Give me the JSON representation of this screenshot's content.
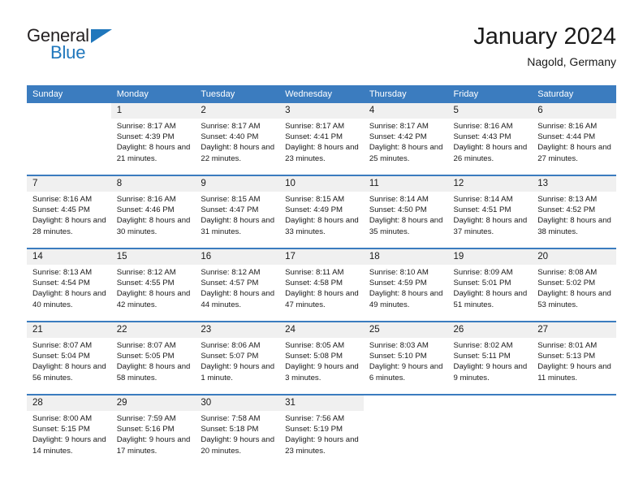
{
  "brand": {
    "name_part1": "General",
    "name_part2": "Blue",
    "accent_color": "#1f77bc"
  },
  "header": {
    "title": "January 2024",
    "subtitle": "Nagold, Germany"
  },
  "calendar": {
    "header_color": "#3b7cbf",
    "weekdays": [
      "Sunday",
      "Monday",
      "Tuesday",
      "Wednesday",
      "Thursday",
      "Friday",
      "Saturday"
    ],
    "weeks": [
      [
        {
          "day": "",
          "sunrise": "",
          "sunset": "",
          "daylight": ""
        },
        {
          "day": "1",
          "sunrise": "Sunrise: 8:17 AM",
          "sunset": "Sunset: 4:39 PM",
          "daylight": "Daylight: 8 hours and 21 minutes."
        },
        {
          "day": "2",
          "sunrise": "Sunrise: 8:17 AM",
          "sunset": "Sunset: 4:40 PM",
          "daylight": "Daylight: 8 hours and 22 minutes."
        },
        {
          "day": "3",
          "sunrise": "Sunrise: 8:17 AM",
          "sunset": "Sunset: 4:41 PM",
          "daylight": "Daylight: 8 hours and 23 minutes."
        },
        {
          "day": "4",
          "sunrise": "Sunrise: 8:17 AM",
          "sunset": "Sunset: 4:42 PM",
          "daylight": "Daylight: 8 hours and 25 minutes."
        },
        {
          "day": "5",
          "sunrise": "Sunrise: 8:16 AM",
          "sunset": "Sunset: 4:43 PM",
          "daylight": "Daylight: 8 hours and 26 minutes."
        },
        {
          "day": "6",
          "sunrise": "Sunrise: 8:16 AM",
          "sunset": "Sunset: 4:44 PM",
          "daylight": "Daylight: 8 hours and 27 minutes."
        }
      ],
      [
        {
          "day": "7",
          "sunrise": "Sunrise: 8:16 AM",
          "sunset": "Sunset: 4:45 PM",
          "daylight": "Daylight: 8 hours and 28 minutes."
        },
        {
          "day": "8",
          "sunrise": "Sunrise: 8:16 AM",
          "sunset": "Sunset: 4:46 PM",
          "daylight": "Daylight: 8 hours and 30 minutes."
        },
        {
          "day": "9",
          "sunrise": "Sunrise: 8:15 AM",
          "sunset": "Sunset: 4:47 PM",
          "daylight": "Daylight: 8 hours and 31 minutes."
        },
        {
          "day": "10",
          "sunrise": "Sunrise: 8:15 AM",
          "sunset": "Sunset: 4:49 PM",
          "daylight": "Daylight: 8 hours and 33 minutes."
        },
        {
          "day": "11",
          "sunrise": "Sunrise: 8:14 AM",
          "sunset": "Sunset: 4:50 PM",
          "daylight": "Daylight: 8 hours and 35 minutes."
        },
        {
          "day": "12",
          "sunrise": "Sunrise: 8:14 AM",
          "sunset": "Sunset: 4:51 PM",
          "daylight": "Daylight: 8 hours and 37 minutes."
        },
        {
          "day": "13",
          "sunrise": "Sunrise: 8:13 AM",
          "sunset": "Sunset: 4:52 PM",
          "daylight": "Daylight: 8 hours and 38 minutes."
        }
      ],
      [
        {
          "day": "14",
          "sunrise": "Sunrise: 8:13 AM",
          "sunset": "Sunset: 4:54 PM",
          "daylight": "Daylight: 8 hours and 40 minutes."
        },
        {
          "day": "15",
          "sunrise": "Sunrise: 8:12 AM",
          "sunset": "Sunset: 4:55 PM",
          "daylight": "Daylight: 8 hours and 42 minutes."
        },
        {
          "day": "16",
          "sunrise": "Sunrise: 8:12 AM",
          "sunset": "Sunset: 4:57 PM",
          "daylight": "Daylight: 8 hours and 44 minutes."
        },
        {
          "day": "17",
          "sunrise": "Sunrise: 8:11 AM",
          "sunset": "Sunset: 4:58 PM",
          "daylight": "Daylight: 8 hours and 47 minutes."
        },
        {
          "day": "18",
          "sunrise": "Sunrise: 8:10 AM",
          "sunset": "Sunset: 4:59 PM",
          "daylight": "Daylight: 8 hours and 49 minutes."
        },
        {
          "day": "19",
          "sunrise": "Sunrise: 8:09 AM",
          "sunset": "Sunset: 5:01 PM",
          "daylight": "Daylight: 8 hours and 51 minutes."
        },
        {
          "day": "20",
          "sunrise": "Sunrise: 8:08 AM",
          "sunset": "Sunset: 5:02 PM",
          "daylight": "Daylight: 8 hours and 53 minutes."
        }
      ],
      [
        {
          "day": "21",
          "sunrise": "Sunrise: 8:07 AM",
          "sunset": "Sunset: 5:04 PM",
          "daylight": "Daylight: 8 hours and 56 minutes."
        },
        {
          "day": "22",
          "sunrise": "Sunrise: 8:07 AM",
          "sunset": "Sunset: 5:05 PM",
          "daylight": "Daylight: 8 hours and 58 minutes."
        },
        {
          "day": "23",
          "sunrise": "Sunrise: 8:06 AM",
          "sunset": "Sunset: 5:07 PM",
          "daylight": "Daylight: 9 hours and 1 minute."
        },
        {
          "day": "24",
          "sunrise": "Sunrise: 8:05 AM",
          "sunset": "Sunset: 5:08 PM",
          "daylight": "Daylight: 9 hours and 3 minutes."
        },
        {
          "day": "25",
          "sunrise": "Sunrise: 8:03 AM",
          "sunset": "Sunset: 5:10 PM",
          "daylight": "Daylight: 9 hours and 6 minutes."
        },
        {
          "day": "26",
          "sunrise": "Sunrise: 8:02 AM",
          "sunset": "Sunset: 5:11 PM",
          "daylight": "Daylight: 9 hours and 9 minutes."
        },
        {
          "day": "27",
          "sunrise": "Sunrise: 8:01 AM",
          "sunset": "Sunset: 5:13 PM",
          "daylight": "Daylight: 9 hours and 11 minutes."
        }
      ],
      [
        {
          "day": "28",
          "sunrise": "Sunrise: 8:00 AM",
          "sunset": "Sunset: 5:15 PM",
          "daylight": "Daylight: 9 hours and 14 minutes."
        },
        {
          "day": "29",
          "sunrise": "Sunrise: 7:59 AM",
          "sunset": "Sunset: 5:16 PM",
          "daylight": "Daylight: 9 hours and 17 minutes."
        },
        {
          "day": "30",
          "sunrise": "Sunrise: 7:58 AM",
          "sunset": "Sunset: 5:18 PM",
          "daylight": "Daylight: 9 hours and 20 minutes."
        },
        {
          "day": "31",
          "sunrise": "Sunrise: 7:56 AM",
          "sunset": "Sunset: 5:19 PM",
          "daylight": "Daylight: 9 hours and 23 minutes."
        },
        {
          "day": "",
          "sunrise": "",
          "sunset": "",
          "daylight": ""
        },
        {
          "day": "",
          "sunrise": "",
          "sunset": "",
          "daylight": ""
        },
        {
          "day": "",
          "sunrise": "",
          "sunset": "",
          "daylight": ""
        }
      ]
    ]
  }
}
